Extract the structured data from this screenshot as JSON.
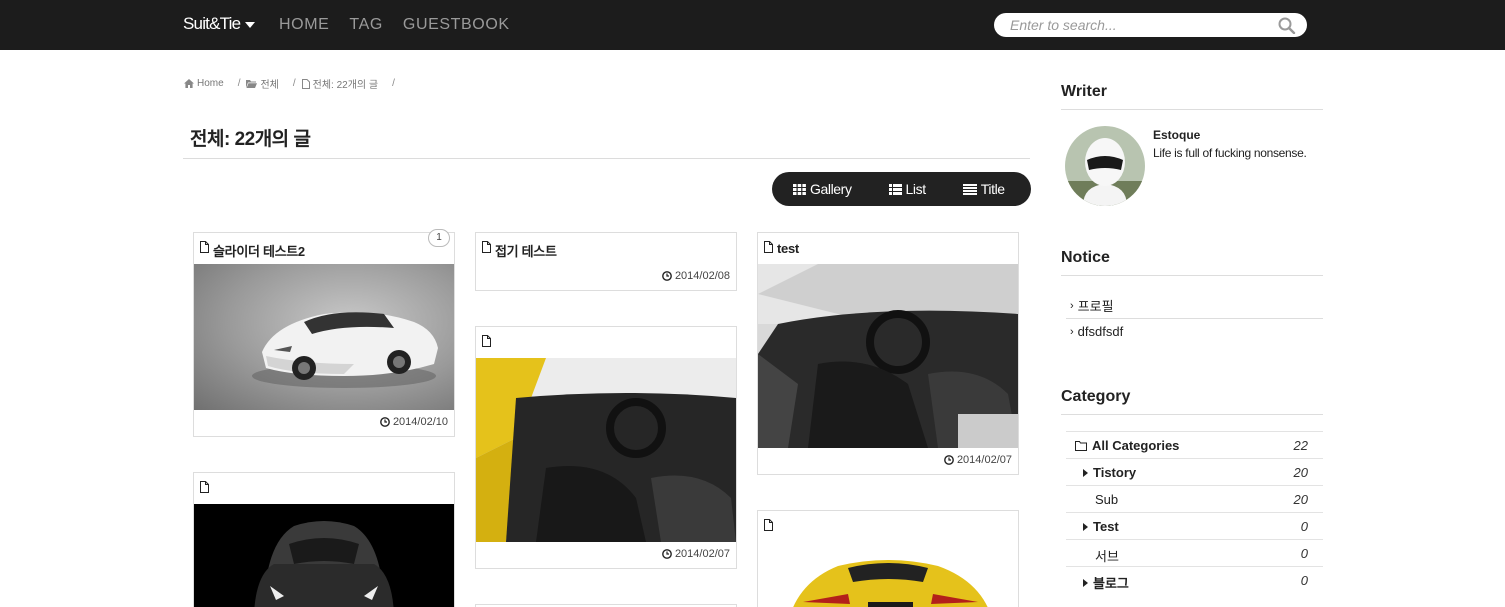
{
  "header": {
    "brand": "Suit&Tie",
    "nav": [
      "HOME",
      "TAG",
      "GUESTBOOK"
    ],
    "search_placeholder": "Enter to search..."
  },
  "breadcrumb": {
    "home": "Home",
    "category": "전체",
    "current": "전체: 22개의 글"
  },
  "page_title": "전체: 22개의 글",
  "view_toggle": {
    "gallery": "Gallery",
    "list": "List",
    "title": "Title"
  },
  "posts": [
    {
      "title": "슬라이더 테스트2",
      "date": "2014/02/10",
      "comments": "1"
    },
    {
      "title": "접기 테스트",
      "date": "2014/02/08"
    },
    {
      "title": "test",
      "date": "2014/02/07"
    },
    {
      "title": "",
      "date": "2014/02/07"
    },
    {
      "title": ""
    },
    {
      "title": ""
    }
  ],
  "sidebar": {
    "writer": {
      "heading": "Writer",
      "name": "Estoque",
      "bio": "Life is full of fucking nonsense."
    },
    "notice": {
      "heading": "Notice",
      "items": [
        "프로필",
        "dfsdfsdf"
      ]
    },
    "category": {
      "heading": "Category",
      "items": [
        {
          "label": "All Categories",
          "count": "22"
        },
        {
          "label": "Tistory",
          "count": "20"
        },
        {
          "label": "Sub",
          "count": "20"
        },
        {
          "label": "Test",
          "count": "0"
        },
        {
          "label": "서브",
          "count": "0"
        },
        {
          "label": "블로그",
          "count": "0"
        }
      ]
    }
  },
  "colors": {
    "topbar": "#1c1c1c",
    "car_white": "#e8e8e8",
    "car_yellow": "#e5c21b"
  }
}
